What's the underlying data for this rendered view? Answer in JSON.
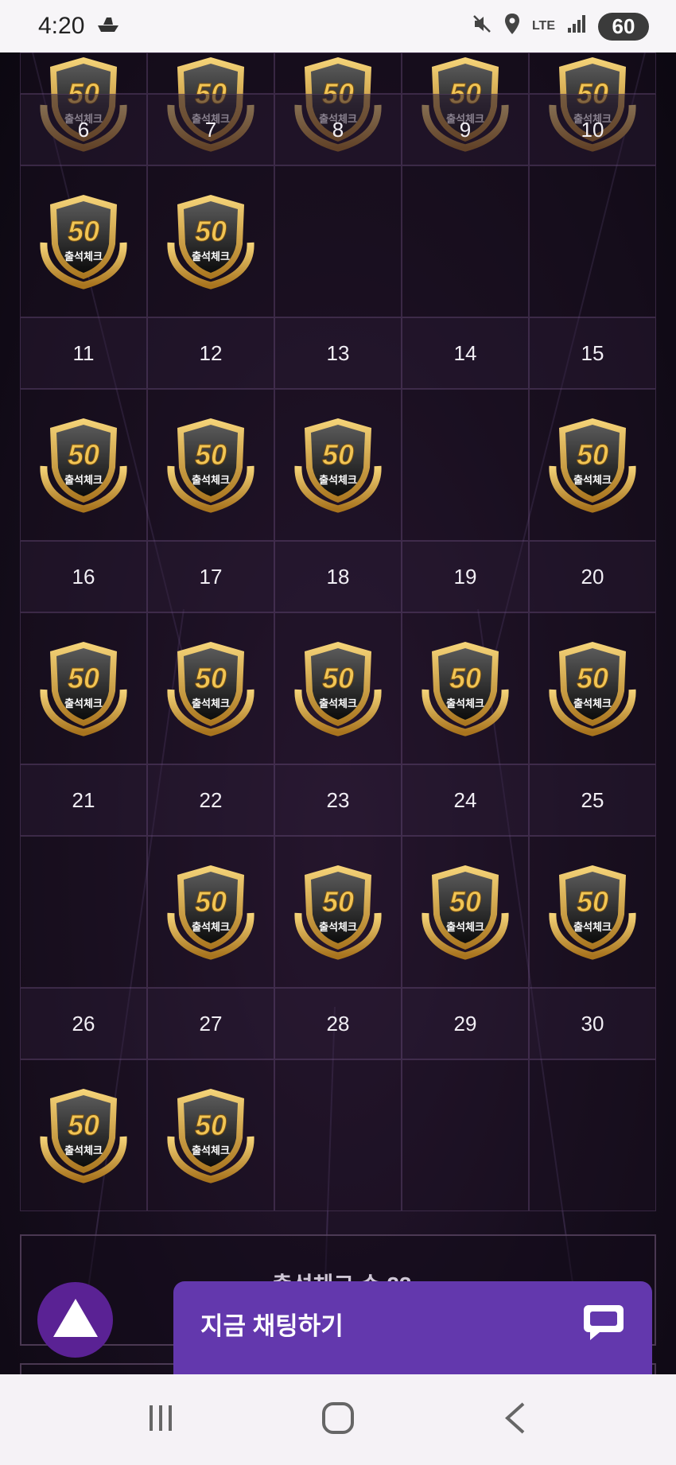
{
  "status_bar": {
    "time": "4:20",
    "network": "LTE",
    "battery": "60",
    "icons": [
      "boat-notification-icon",
      "mute-icon",
      "location-icon",
      "lte-icon",
      "signal-icon",
      "battery-icon"
    ]
  },
  "calendar": {
    "badge": {
      "number": "50",
      "caption": "출석체크",
      "icon": "attendance-badge-icon"
    },
    "weeks": [
      {
        "days": [
          "6",
          "7",
          "8",
          "9",
          "10"
        ],
        "checked": [
          true,
          true,
          false,
          false,
          false
        ]
      },
      {
        "days": [
          "11",
          "12",
          "13",
          "14",
          "15"
        ],
        "checked": [
          true,
          true,
          true,
          false,
          true
        ]
      },
      {
        "days": [
          "16",
          "17",
          "18",
          "19",
          "20"
        ],
        "checked": [
          true,
          true,
          true,
          true,
          true
        ]
      },
      {
        "days": [
          "21",
          "22",
          "23",
          "24",
          "25"
        ],
        "checked": [
          false,
          true,
          true,
          true,
          true
        ]
      },
      {
        "days": [
          "26",
          "27",
          "28",
          "29",
          "30"
        ],
        "checked": [
          true,
          true,
          false,
          false,
          false
        ]
      }
    ]
  },
  "summary": {
    "text": "출석체크 수 22"
  },
  "chat_button": {
    "label": "지금 채팅하기",
    "icon": "chat-bubble-icon"
  },
  "scroll_top": {
    "icon": "triangle-up-icon"
  },
  "nav": {
    "recent": "recent-apps-icon",
    "home": "home-icon",
    "back": "back-icon"
  },
  "colors": {
    "accent": "#6338ad",
    "scroll_button": "#5a2294",
    "badge_gold": "#d9a93a"
  }
}
